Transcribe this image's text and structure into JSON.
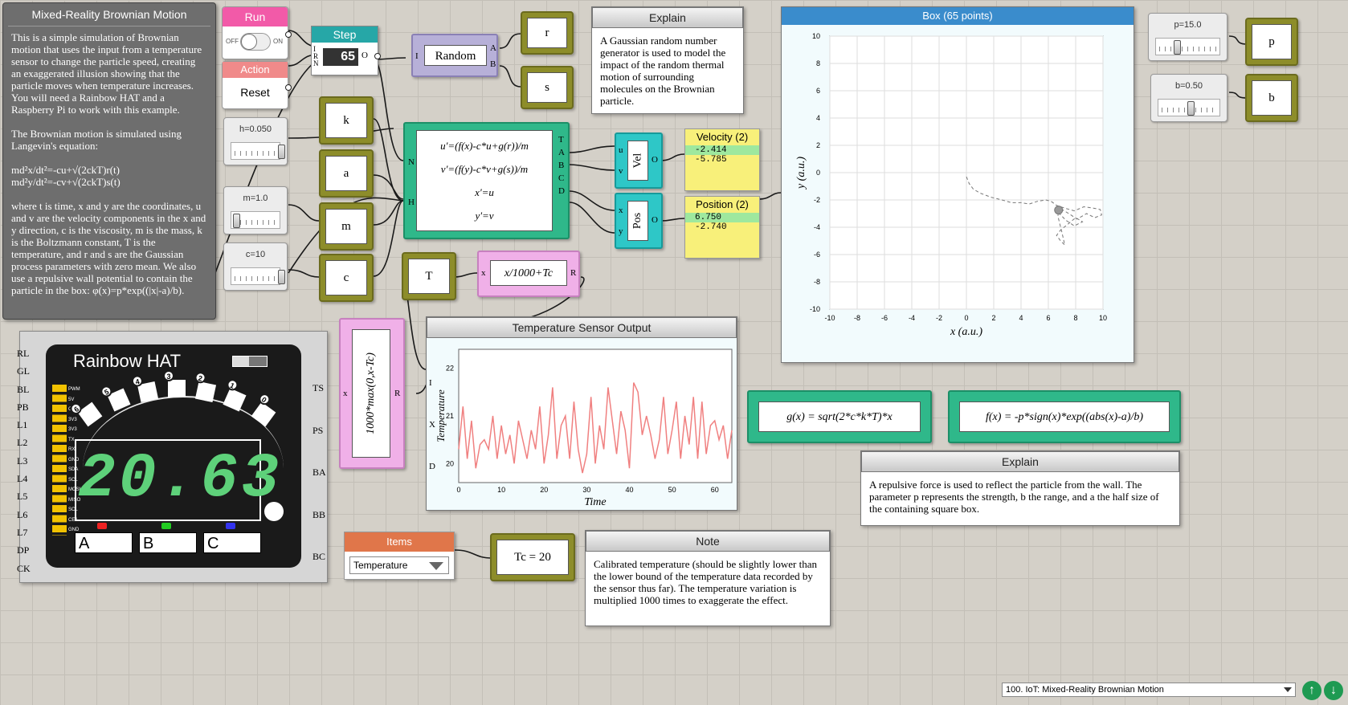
{
  "intro": {
    "title": "Mixed-Reality Brownian Motion",
    "p1": "This is a simple simulation of Brownian motion that uses the input from a temperature sensor to change the particle speed, creating an exaggerated illusion showing that the particle moves when temperature increases. You will need a Rainbow HAT and a Raspberry Pi to work with this example.",
    "p2": "The Brownian motion is simulated using Langevin's equation:",
    "eq1": "md²x/dt²=-cu+√(2ckT)r(t)",
    "eq2": "md²y/dt²=-cv+√(2ckT)s(t)",
    "p3": "where t is time, x and y are the coordinates, u and v are the velocity components in the x and y direction, c is the viscosity, m is the mass, k is the Boltzmann constant, T is the temperature, and r and s are the Gaussian process parameters with zero mean. We also use a repulsive wall potential to contain the particle in the box: φ(x)=p*exp((|x|-a)/b)."
  },
  "run": {
    "title": "Run",
    "off": "OFF",
    "on": "ON"
  },
  "action": {
    "title": "Action",
    "label": "Reset"
  },
  "step": {
    "title": "Step",
    "value": "65",
    "ports": [
      "I",
      "R",
      "N"
    ],
    "out": "O"
  },
  "random": {
    "label": "Random",
    "in": "I",
    "outs": [
      "A",
      "B"
    ]
  },
  "vars": {
    "r": "r",
    "s": "s",
    "k": "k",
    "a": "a",
    "m": "m",
    "c": "c",
    "T": "T",
    "p": "p",
    "b": "b"
  },
  "sliders": {
    "h": "h=0.050",
    "m": "m=1.0",
    "c": "c=10",
    "p": "p=15.0",
    "b": "b=0.50"
  },
  "explain1": {
    "title": "Explain",
    "text": "A Gaussian random number generator is used to model the impact of the random thermal motion of surrounding molecules on the Brownian particle."
  },
  "equations": {
    "l1": "u'=(f(x)-c*u+g(r))/m",
    "l2": "v'=(f(y)-c*v+g(s))/m",
    "l3": "x'=u",
    "l4": "y'=v",
    "inN": "N",
    "inH": "H",
    "outs": [
      "T",
      "A",
      "B",
      "C",
      "D"
    ]
  },
  "vel": {
    "label": "Vel",
    "u": "u",
    "v": "v",
    "o": "O"
  },
  "pos": {
    "label": "Pos",
    "x": "x",
    "y": "y",
    "o": "O"
  },
  "velocity": {
    "title": "Velocity (2)",
    "v1": "-2.414",
    "v2": "-5.785"
  },
  "position": {
    "title": "Position (2)",
    "v1": "6.750",
    "v2": "-2.740"
  },
  "box": {
    "title": "Box (65 points)",
    "xlabel": "x (a.u.)",
    "ylabel": "y (a.u.)",
    "ticks": [
      "-10",
      "-8",
      "-6",
      "-4",
      "-2",
      "0",
      "2",
      "4",
      "6",
      "8",
      "10"
    ]
  },
  "tfunc": {
    "expr": "x/1000+Tc",
    "in": "x",
    "out": "R"
  },
  "maxfunc": {
    "expr": "1000*max(0,x-Tc)",
    "in": "x",
    "out": "R"
  },
  "tempchart": {
    "title": "Temperature Sensor Output",
    "xlabel": "Time",
    "ylabel": "Temperature",
    "ports": [
      "I",
      "X",
      "D"
    ],
    "xticks": [
      "0",
      "10",
      "20",
      "30",
      "40",
      "50",
      "60"
    ],
    "yticks": [
      "22",
      "21",
      "20"
    ]
  },
  "gx": "g(x) = sqrt(2*c*k*T)*x",
  "fx": "f(x) = -p*sign(x)*exp((abs(x)-a)/b)",
  "explain2": {
    "title": "Explain",
    "text": "A repulsive force is used to reflect the particle from the wall. The parameter p represents the strength, b the range, and a the half size of the containing square box."
  },
  "hat": {
    "title": "Rainbow HAT",
    "left_ports": [
      "RL",
      "GL",
      "BL",
      "PB",
      "L1",
      "L2",
      "L3",
      "L4",
      "L5",
      "L6",
      "L7",
      "DP",
      "CK"
    ],
    "right_ports": [
      "TS",
      "PS",
      "BA",
      "BB",
      "BC"
    ],
    "digits": "20.63",
    "btns": [
      "A",
      "B",
      "C"
    ],
    "pins": [
      "PWM",
      "5V",
      "GND",
      "3V3",
      "3V3",
      "TX",
      "RX",
      "GND",
      "SDA",
      "SCL",
      "MOSI",
      "MISO",
      "SCL",
      "CE1",
      "GND"
    ],
    "leds": [
      "6",
      "5",
      "4",
      "3",
      "2",
      "1",
      "0"
    ]
  },
  "items": {
    "title": "Items",
    "selected": "Temperature"
  },
  "tc": "Tc = 20",
  "note": {
    "title": "Note",
    "text": "Calibrated temperature (should be slightly lower than the lower bound of the temperature data recorded by the sensor thus far). The temperature variation is multiplied 1000 times to exaggerate the effect."
  },
  "footer": {
    "selected": "100. IoT: Mixed-Reality Brownian Motion"
  },
  "chart_data": [
    {
      "type": "line",
      "title": "Temperature Sensor Output",
      "xlabel": "Time",
      "ylabel": "Temperature",
      "xlim": [
        0,
        64
      ],
      "ylim": [
        19.6,
        22.4
      ],
      "color": "#f08080",
      "x": [
        0,
        1,
        2,
        3,
        4,
        5,
        6,
        7,
        8,
        9,
        10,
        11,
        12,
        13,
        14,
        15,
        16,
        17,
        18,
        19,
        20,
        21,
        22,
        23,
        24,
        25,
        26,
        27,
        28,
        29,
        30,
        31,
        32,
        33,
        34,
        35,
        36,
        37,
        38,
        39,
        40,
        41,
        42,
        43,
        44,
        45,
        46,
        47,
        48,
        49,
        50,
        51,
        52,
        53,
        54,
        55,
        56,
        57,
        58,
        59,
        60,
        61,
        62,
        63,
        64
      ],
      "y": [
        20.3,
        21.2,
        20.1,
        20.9,
        19.9,
        20.4,
        20.5,
        20.3,
        21.0,
        20.1,
        20.8,
        20.2,
        20.6,
        20.0,
        20.9,
        20.5,
        20.1,
        20.7,
        20.3,
        21.2,
        20.0,
        20.6,
        21.6,
        20.1,
        20.8,
        21.0,
        20.1,
        21.3,
        20.3,
        19.8,
        20.2,
        21.4,
        20.0,
        20.8,
        20.3,
        21.6,
        20.9,
        20.2,
        21.1,
        20.7,
        19.9,
        21.7,
        21.5,
        20.6,
        21.0,
        20.6,
        20.1,
        20.5,
        21.4,
        20.2,
        20.7,
        21.3,
        20.1,
        21.0,
        20.4,
        21.4,
        20.1,
        21.3,
        20.2,
        20.8,
        20.9,
        20.5,
        20.8,
        20.1,
        20.7
      ]
    },
    {
      "type": "scatter",
      "title": "Box (65 points)",
      "xlabel": "x (a.u.)",
      "ylabel": "y (a.u.)",
      "xlim": [
        -10,
        10
      ],
      "ylim": [
        -10,
        10
      ],
      "grid": true,
      "x": [
        0.0,
        0.2,
        0.5,
        1.0,
        1.8,
        2.6,
        3.3,
        4.0,
        4.6,
        5.2,
        5.8,
        6.2,
        6.6,
        7.2,
        7.9,
        8.6,
        9.3,
        9.8,
        9.9,
        9.4,
        8.8,
        8.1,
        7.5,
        7.0,
        6.8,
        7.3,
        7.9,
        8.5,
        8.0,
        7.4,
        6.9,
        6.6,
        6.9,
        7.2,
        7.0,
        6.7,
        6.75
      ],
      "y": [
        -0.3,
        -0.8,
        -1.2,
        -1.5,
        -1.8,
        -2.0,
        -2.2,
        -2.2,
        -2.3,
        -2.1,
        -2.0,
        -2.1,
        -2.4,
        -2.6,
        -2.8,
        -2.5,
        -2.6,
        -2.7,
        -3.1,
        -3.3,
        -3.0,
        -3.4,
        -3.0,
        -2.7,
        -3.0,
        -3.5,
        -3.9,
        -3.6,
        -3.3,
        -3.8,
        -4.2,
        -4.6,
        -5.0,
        -5.3,
        -4.4,
        -3.2,
        -2.74
      ]
    }
  ]
}
